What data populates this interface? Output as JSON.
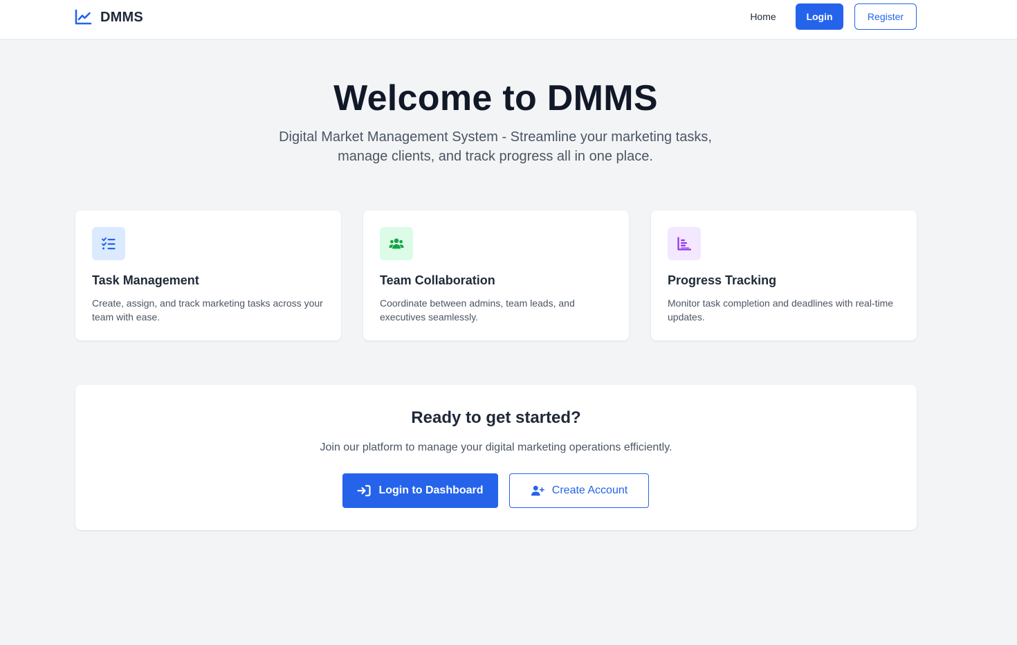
{
  "navbar": {
    "brand": "DMMS",
    "brand_icon": "chart-line-icon",
    "home_label": "Home",
    "login_label": "Login",
    "register_label": "Register"
  },
  "hero": {
    "title": "Welcome to DMMS",
    "subtitle": "Digital Market Management System - Streamline your marketing tasks, manage clients, and track progress all in one place."
  },
  "features": [
    {
      "title": "Task Management",
      "description": "Create, assign, and track marketing tasks across your team with ease.",
      "icon": "task-list-icon",
      "icon_color": "#2563eb",
      "icon_bg": "#dbeafe"
    },
    {
      "title": "Team Collaboration",
      "description": "Coordinate between admins, team leads, and executives seamlessly.",
      "icon": "users-icon",
      "icon_color": "#16a34a",
      "icon_bg": "#dcfce7"
    },
    {
      "title": "Progress Tracking",
      "description": "Monitor task completion and deadlines with real-time updates.",
      "icon": "bar-chart-icon",
      "icon_color": "#9333ea",
      "icon_bg": "#f3e8ff"
    }
  ],
  "cta": {
    "title": "Ready to get started?",
    "text": "Join our platform to manage your digital marketing operations efficiently.",
    "login_button": "Login to Dashboard",
    "login_icon": "sign-in-icon",
    "create_button": "Create Account",
    "create_icon": "user-plus-icon"
  },
  "colors": {
    "primary": "#2563eb",
    "background": "#f3f4f6",
    "heading": "#111827",
    "muted": "#4b5563"
  }
}
